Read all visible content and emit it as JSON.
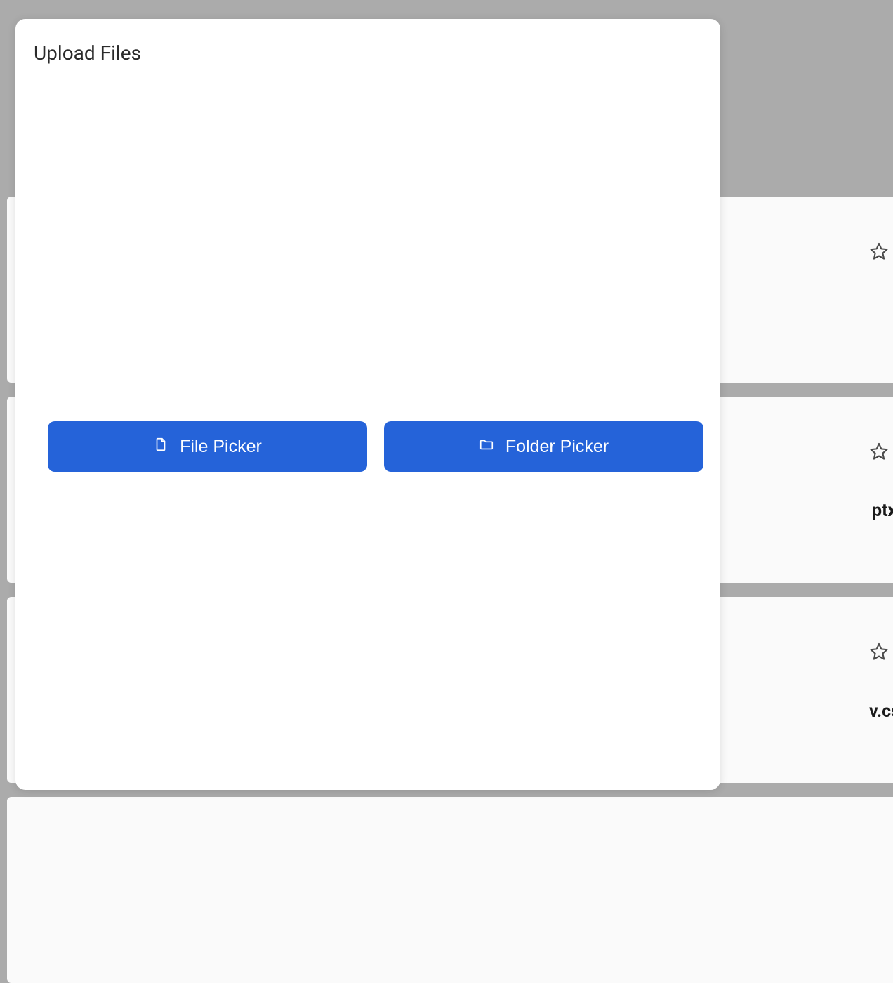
{
  "modal": {
    "title": "Upload Files",
    "buttons": {
      "file_picker": "File Picker",
      "folder_picker": "Folder Picker"
    }
  },
  "background": {
    "text_fragments": {
      "row2": "ptx",
      "row3": "v.cs"
    }
  },
  "colors": {
    "button_bg": "#2563d9",
    "modal_bg": "#ffffff",
    "page_bg": "#ababab"
  }
}
